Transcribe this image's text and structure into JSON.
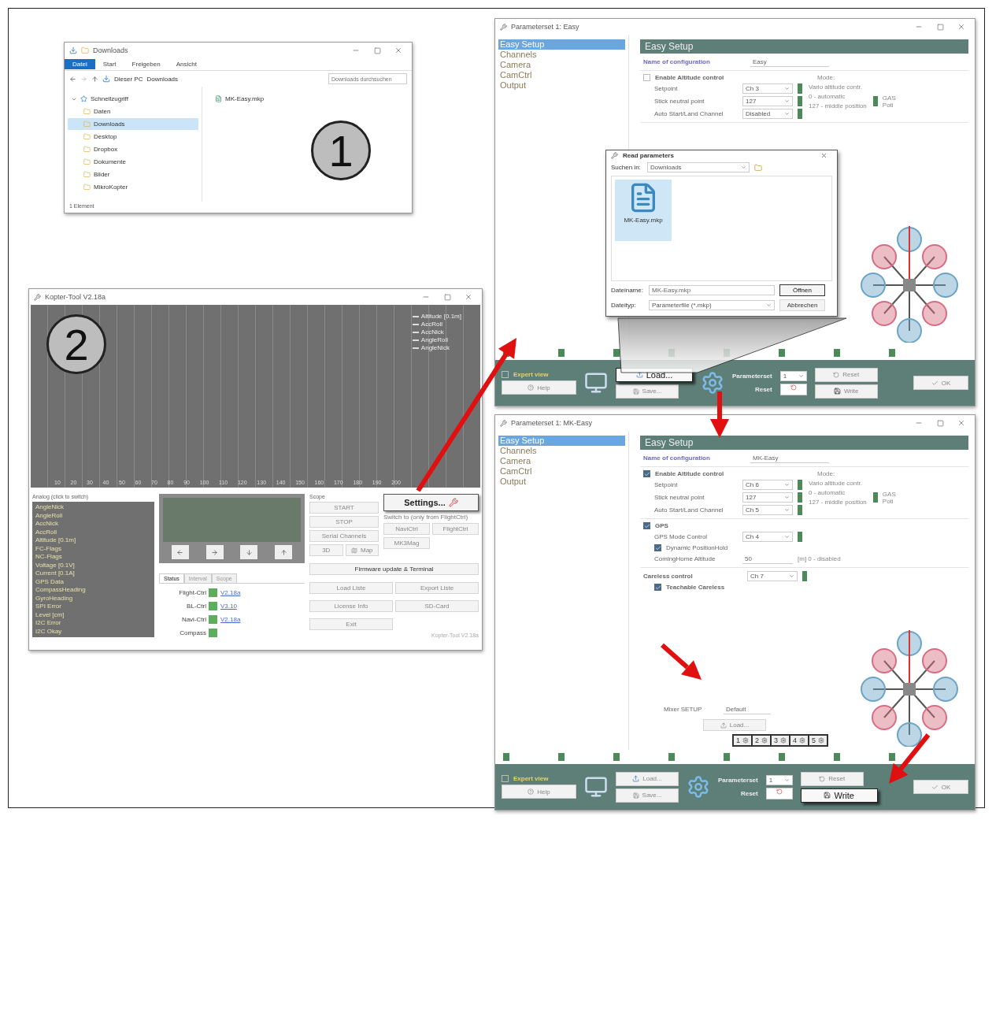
{
  "explorer": {
    "title": "Downloads",
    "ribbon_tabs": [
      {
        "label": "Datei",
        "selected": true
      },
      {
        "label": "Start",
        "selected": false
      },
      {
        "label": "Freigeben",
        "selected": false
      },
      {
        "label": "Ansicht",
        "selected": false
      }
    ],
    "path": [
      "Dieser PC",
      "Downloads"
    ],
    "search": {
      "placeholder": "Downloads durchsuchen"
    },
    "tree": [
      {
        "label": "Schnellzugriff",
        "expanded": true,
        "children": [
          {
            "label": "Daten",
            "selected": false
          },
          {
            "label": "Downloads",
            "selected": true
          },
          {
            "label": "Desktop",
            "selected": false
          },
          {
            "label": "Dropbox",
            "selected": false
          },
          {
            "label": "Dokumente",
            "selected": false
          },
          {
            "label": "Bilder",
            "selected": false
          },
          {
            "label": "MikroKopter",
            "selected": false
          }
        ]
      }
    ],
    "files": [
      "MK-Easy.mkp"
    ],
    "status": "1 Element",
    "badge": "1"
  },
  "tool": {
    "title": "Kopter-Tool V2.18a",
    "badge": "2",
    "legend": [
      "Altitude [0.1m]",
      "AccRoll",
      "AccNick",
      "AngleRoll",
      "AngleNick"
    ],
    "x_ticks": [
      "10",
      "20",
      "30",
      "40",
      "50",
      "60",
      "70",
      "80",
      "90",
      "100",
      "110",
      "120",
      "130",
      "140",
      "150",
      "160",
      "170",
      "180",
      "190",
      "200"
    ],
    "analog_title": "Analog (click to switch)",
    "analog_items": [
      "AngleNick",
      "AngleRoll",
      "AccNick",
      "AccRoll",
      "Altitude [0.1m]",
      "FC-Flags",
      "NC-Flags",
      "Voltage [0.1V]",
      "Current [0.1A]",
      "GPS Data",
      "CompassHeading",
      "GyroHeading",
      "SPI Error",
      "Level [cm]",
      "I2C Error",
      "I2C Okay"
    ],
    "tabs": [
      {
        "label": "Status",
        "selected": true
      },
      {
        "label": "Interval",
        "selected": false
      },
      {
        "label": "Scope",
        "selected": false
      }
    ],
    "versions": [
      {
        "label": "Flight-Ctrl",
        "value": "V2.18a"
      },
      {
        "label": "BL-Ctrl",
        "value": "V3.10"
      },
      {
        "label": "Navi-Ctrl",
        "value": "V2.18a"
      },
      {
        "label": "Compass"
      }
    ],
    "scope_title": "Scope",
    "scope_buttons": [
      "START",
      "STOP"
    ],
    "tool_buttons": [
      "Serial Channels",
      "3D",
      "Map"
    ],
    "settings_button": "Settings...",
    "switch_label": "Switch to (only from FlightCtrl)",
    "switch_buttons": [
      "NaviCtrl",
      "FlightCtrl",
      "MK3Mag"
    ],
    "firmware_button": "Firmware update & Terminal",
    "action_buttons": [
      "Load Liste",
      "Export Liste",
      "License Info",
      "SD-Card",
      "Exit"
    ],
    "footer": "Kopter-Tool V2.18a"
  },
  "parameter_windows": [
    {
      "title": "Parameterset 1: Easy",
      "nav": [
        {
          "label": "Easy Setup",
          "selected": true
        },
        {
          "label": "Channels",
          "selected": false
        },
        {
          "label": "Camera",
          "selected": false
        },
        {
          "label": "CamCtrl",
          "selected": false
        },
        {
          "label": "Output",
          "selected": false
        }
      ],
      "header": "Easy Setup",
      "config_label": "Name of configuration",
      "config_value": "Easy",
      "altitude": {
        "label": "Enable Altitude control",
        "checked": false,
        "mode_label": "Mode:",
        "mode_value": "Vario altitude contr.",
        "rows": [
          {
            "label": "Setpoint",
            "value": "Ch 3"
          },
          {
            "label": "Stick neutral point",
            "value": "127"
          },
          {
            "label": "Auto Start/Land Channel",
            "value": "Disabled"
          }
        ],
        "hints": [
          "0 - automatic",
          "127 - middle position"
        ],
        "gas_labels": [
          "GAS",
          "Poti"
        ]
      },
      "dialog": {
        "title": "Read parameters",
        "look_in_label": "Suchen in:",
        "look_in": "Downloads",
        "file": "MK-Easy.mkp",
        "filename_label": "Dateiname:",
        "filename": "MK-Easy.mkp",
        "type_label": "Dateityp:",
        "type": "Parameterfile (*.mkp)",
        "buttons": [
          "Öffnen",
          "Abbrechen"
        ]
      },
      "bar": {
        "expert": {
          "label": "Expert view",
          "checked": false
        },
        "help": "Help",
        "load": "Load...",
        "save": "Save...",
        "paramset_label": "Parameterset",
        "paramset_value": "1",
        "reset_label": "Reset",
        "buttons": [
          "Reset",
          "Write"
        ],
        "ok": "OK",
        "load_emphasized": true,
        "write_emphasized": false
      }
    },
    {
      "title": "Parameterset 1: MK-Easy",
      "nav": [
        {
          "label": "Easy Setup",
          "selected": true
        },
        {
          "label": "Channels",
          "selected": false
        },
        {
          "label": "Camera",
          "selected": false
        },
        {
          "label": "CamCtrl",
          "selected": false
        },
        {
          "label": "Output",
          "selected": false
        }
      ],
      "header": "Easy Setup",
      "config_label": "Name of configuration",
      "config_value": "MK-Easy",
      "altitude": {
        "label": "Enable Altitude control",
        "checked": true,
        "mode_label": "Mode:",
        "mode_value": "Vario altitude contr.",
        "rows": [
          {
            "label": "Setpoint",
            "value": "Ch 6"
          },
          {
            "label": "Stick neutral point",
            "value": "127"
          },
          {
            "label": "Auto Start/Land Channel",
            "value": "Ch 5"
          }
        ],
        "hints": [
          "0 - automatic",
          "127 - middle position"
        ],
        "gas_labels": [
          "GAS",
          "Poti"
        ]
      },
      "gps": {
        "label": "GPS",
        "checked": true,
        "mode_label": "GPS Mode Control",
        "mode_value": "Ch 4",
        "dynamic": {
          "label": "Dynamic PositionHold",
          "checked": true
        },
        "home_label": "ComingHome Altitude",
        "home_value": "50",
        "home_hint": "[m] 0 - disabled"
      },
      "careless": {
        "label": "Careless control",
        "value": "Ch 7",
        "teach": {
          "label": "Teachable Careless",
          "checked": true
        }
      },
      "mixer": {
        "label": "Mixer SETUP",
        "value": "Default",
        "button": "Load..."
      },
      "paramset_popup": [
        "1",
        "2",
        "3",
        "4",
        "5"
      ],
      "bar": {
        "expert": {
          "label": "Expert view",
          "checked": false
        },
        "help": "Help",
        "load": "Load...",
        "save": "Save...",
        "paramset_label": "Parameterset",
        "paramset_value": "1",
        "reset_label": "Reset",
        "buttons": [
          "Reset",
          "Write"
        ],
        "ok": "OK",
        "load_emphasized": false,
        "write_emphasized": true
      }
    }
  ]
}
